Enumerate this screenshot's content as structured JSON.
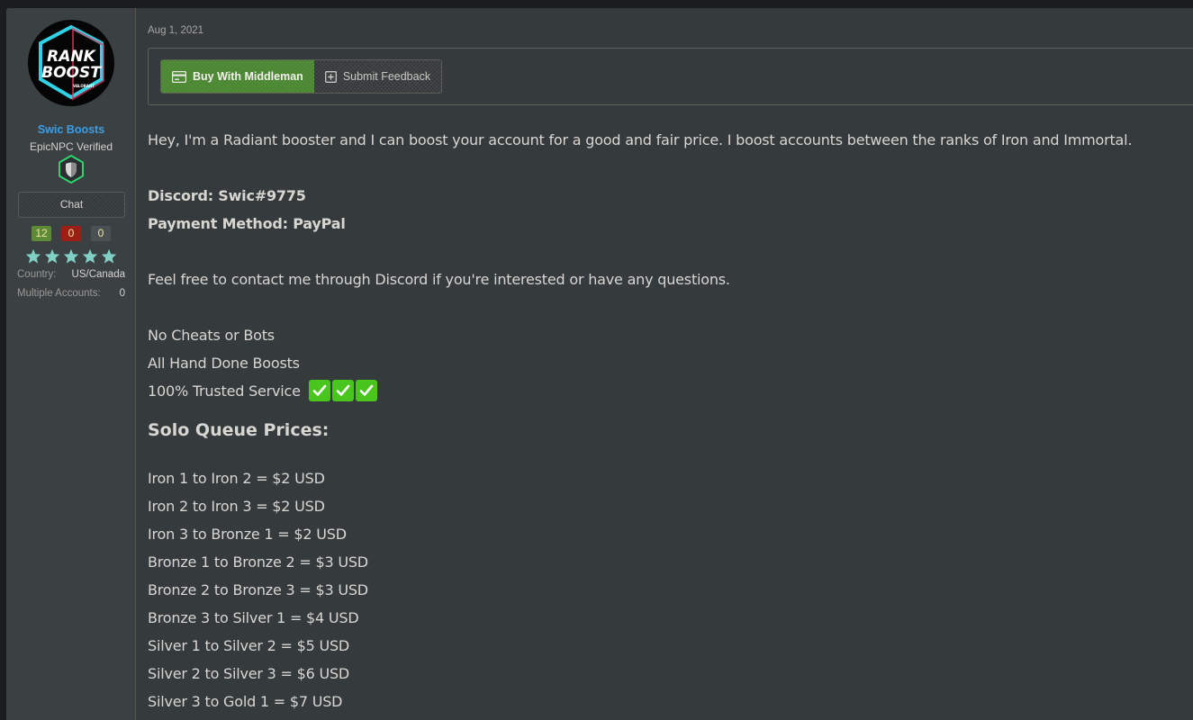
{
  "user": {
    "avatar_text_line1": "RANK",
    "avatar_text_line2": "BOOST",
    "avatar_text_small": "VALORANT",
    "username": "Swic Boosts",
    "title": "EpicNPC Verified",
    "badge_icon": "verified-shield-icon",
    "chat_label": "Chat",
    "feedback_counts": {
      "positive": "12",
      "negative": "0",
      "neutral": "0"
    },
    "rating_stars": 5,
    "rating_max": 5,
    "info": [
      {
        "key": "Country:",
        "value": "US/Canada"
      },
      {
        "key": "Multiple Accounts:",
        "value": "0"
      }
    ]
  },
  "post": {
    "date": "Aug 1, 2021",
    "actions": {
      "buy_label": "Buy With Middleman",
      "buy_icon": "credit-card-icon",
      "feedback_label": "Submit Feedback",
      "feedback_icon": "plus-square-icon"
    },
    "intro": "Hey, I'm a Radiant booster and I can boost your account for a good and fair price. I boost accounts between the ranks of Iron and Immortal.",
    "discord": "Discord: Swic#9775",
    "payment": "Payment Method: PayPal",
    "contact": "Feel free to contact me through Discord if you're interested or have any questions.",
    "features": [
      "No Cheats or Bots",
      "All Hand Done Boosts",
      "100% Trusted Service"
    ],
    "check_emoji": "✓",
    "check_count": 3,
    "prices_heading": "Solo Queue Prices:",
    "prices": [
      "Iron 1 to Iron 2 = $2 USD",
      "Iron 2 to Iron 3 = $2 USD",
      "Iron 3 to Bronze 1 = $2 USD",
      "Bronze 1 to Bronze 2 = $3 USD",
      "Bronze 2 to Bronze 3 = $3 USD",
      "Bronze 3 to Silver 1 = $4 USD",
      "Silver 1 to Silver 2 = $5 USD",
      "Silver 2 to Silver 3 = $6 USD",
      "Silver 3 to Gold 1 = $7 USD"
    ]
  },
  "colors": {
    "username": "#3d9ee4",
    "buy_button": "#4c8a33",
    "positive": "#5c8a35",
    "negative": "#9b1f15",
    "star": "#7fcfc4",
    "check": "#49c51e"
  }
}
